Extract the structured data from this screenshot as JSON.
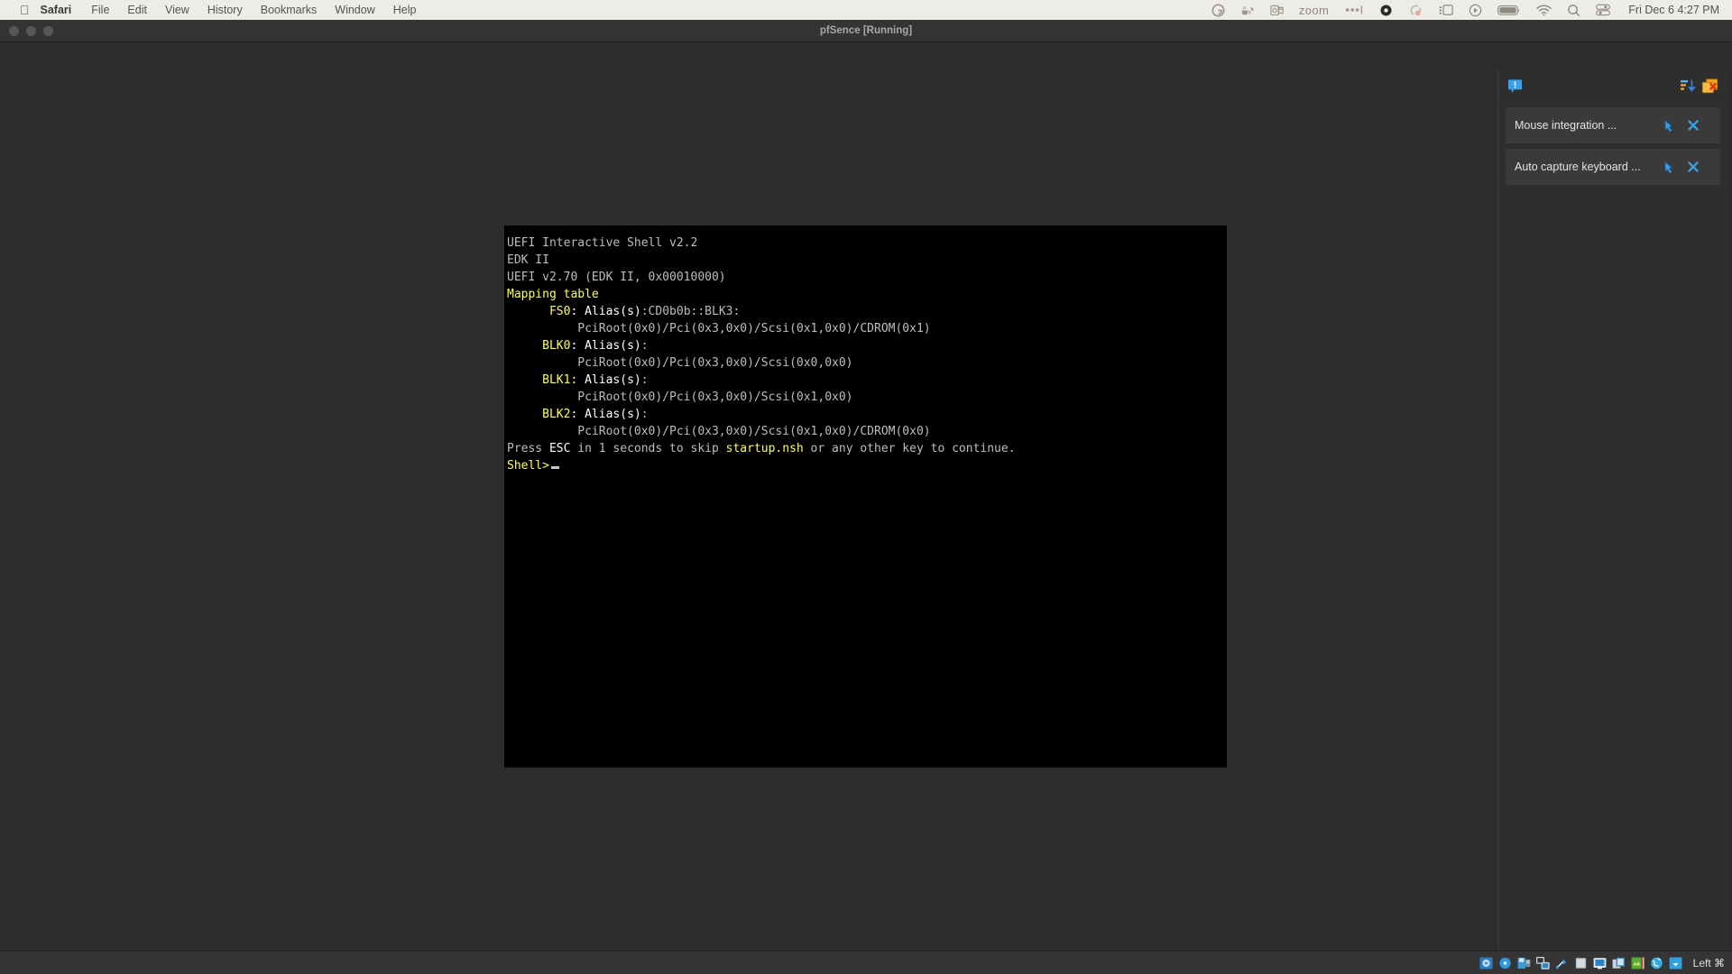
{
  "menubar": {
    "apple_icon": "apple-logo-icon",
    "items": [
      {
        "label": "Safari",
        "bold": true
      },
      {
        "label": "File",
        "bold": false
      },
      {
        "label": "Edit",
        "bold": false
      },
      {
        "label": "View",
        "bold": false
      },
      {
        "label": "History",
        "bold": false
      },
      {
        "label": "Bookmarks",
        "bold": false
      },
      {
        "label": "Window",
        "bold": false
      },
      {
        "label": "Help",
        "bold": false
      }
    ],
    "status_items": [
      {
        "name": "grammarly-icon",
        "glyph": "G"
      },
      {
        "name": "tea-leaf-icon",
        "glyph": ""
      },
      {
        "name": "outlook-icon",
        "glyph": ""
      },
      {
        "name": "zoom-icon",
        "glyph": "zoom"
      },
      {
        "name": "menu-overflow-icon",
        "glyph": ""
      },
      {
        "name": "dropbox-icon",
        "glyph": ""
      },
      {
        "name": "screen-record-icon",
        "glyph": ""
      },
      {
        "name": "stage-manager-icon",
        "glyph": ""
      },
      {
        "name": "now-playing-icon",
        "glyph": ""
      },
      {
        "name": "battery-icon",
        "glyph": ""
      },
      {
        "name": "wifi-icon",
        "glyph": ""
      },
      {
        "name": "spotlight-search-icon",
        "glyph": ""
      },
      {
        "name": "control-center-icon",
        "glyph": ""
      }
    ],
    "clock": "Fri Dec 6  4:27 PM"
  },
  "window": {
    "title": "pfSence [Running]",
    "traffic_lights": [
      "close-button",
      "minimize-button",
      "zoom-button"
    ]
  },
  "console": {
    "lines": [
      [
        {
          "t": "UEFI Interactive Shell v2.2",
          "c": "g"
        }
      ],
      [
        {
          "t": "EDK II",
          "c": "g"
        }
      ],
      [
        {
          "t": "UEFI v2.70 (EDK II, 0x00010000)",
          "c": "g"
        }
      ],
      [
        {
          "t": "Mapping table",
          "c": "y"
        }
      ],
      [
        {
          "t": "      FS0",
          "c": "y"
        },
        {
          "t": ": ",
          "c": "w"
        },
        {
          "t": "Alias(s)",
          "c": "w"
        },
        {
          "t": ":CD0b0b::BLK3:",
          "c": "g"
        }
      ],
      [
        {
          "t": "          PciRoot(0x0)/Pci(0x3,0x0)/Scsi(0x1,0x0)/CDROM(0x1)",
          "c": "g"
        }
      ],
      [
        {
          "t": "     BLK0",
          "c": "y"
        },
        {
          "t": ": ",
          "c": "w"
        },
        {
          "t": "Alias(s)",
          "c": "w"
        },
        {
          "t": ":",
          "c": "g"
        }
      ],
      [
        {
          "t": "          PciRoot(0x0)/Pci(0x3,0x0)/Scsi(0x0,0x0)",
          "c": "g"
        }
      ],
      [
        {
          "t": "     BLK1",
          "c": "y"
        },
        {
          "t": ": ",
          "c": "w"
        },
        {
          "t": "Alias(s)",
          "c": "w"
        },
        {
          "t": ":",
          "c": "g"
        }
      ],
      [
        {
          "t": "          PciRoot(0x0)/Pci(0x3,0x0)/Scsi(0x1,0x0)",
          "c": "g"
        }
      ],
      [
        {
          "t": "     BLK2",
          "c": "y"
        },
        {
          "t": ": ",
          "c": "w"
        },
        {
          "t": "Alias(s)",
          "c": "w"
        },
        {
          "t": ":",
          "c": "g"
        }
      ],
      [
        {
          "t": "          PciRoot(0x0)/Pci(0x3,0x0)/Scsi(0x1,0x0)/CDROM(0x0)",
          "c": "g"
        }
      ],
      [
        {
          "t": "Press ",
          "c": "g"
        },
        {
          "t": "ESC",
          "c": "w"
        },
        {
          "t": " in 1 seconds to skip ",
          "c": "g"
        },
        {
          "t": "startup.nsh",
          "c": "y"
        },
        {
          "t": " or any other key to continue.",
          "c": "g"
        }
      ],
      [
        {
          "t": "Shell>",
          "c": "y"
        }
      ]
    ],
    "prompt_cursor": "_"
  },
  "notifications": {
    "header": {
      "info_icon": "info-balloon-icon",
      "sort_icon": "sort-descending-icon",
      "clear_icon": "remove-all-icon"
    },
    "items": [
      {
        "text": "Mouse integration ...",
        "expand_icon": "expand-arrow-icon",
        "close_icon": "close-x-icon"
      },
      {
        "text": "Auto capture keyboard ...",
        "expand_icon": "expand-arrow-icon",
        "close_icon": "close-x-icon"
      }
    ]
  },
  "statusbar": {
    "icons": [
      {
        "name": "hard-disk-icon"
      },
      {
        "name": "optical-disk-icon"
      },
      {
        "name": "floppy-disk-icon"
      },
      {
        "name": "network-adapter-icon"
      },
      {
        "name": "usb-icon"
      },
      {
        "name": "shared-folder-icon"
      },
      {
        "name": "display-icon"
      },
      {
        "name": "video-capture-icon"
      },
      {
        "name": "mouse-integration-icon"
      },
      {
        "name": "host-key-globe-icon"
      },
      {
        "name": "guest-additions-icon"
      }
    ],
    "host_key_label": "Left ⌘"
  },
  "colors": {
    "menubar_bg": "#eeece6",
    "window_bg": "#2c2c2c",
    "titlebar_bg": "#343434",
    "console_bg": "#000000",
    "console_fg": "#c8c8c8",
    "console_yellow": "#ffff55",
    "panel_bg": "#2e2e2e",
    "card_bg": "#3a3a3a",
    "accent_blue": "#3aa0e8"
  }
}
